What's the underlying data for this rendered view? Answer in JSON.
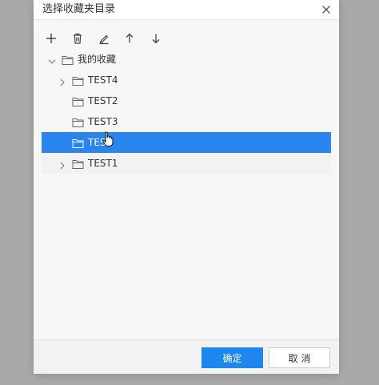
{
  "dialog": {
    "title": "选择收藏夹目录",
    "close_icon": "close-icon"
  },
  "toolbar": {
    "items": [
      {
        "name": "add-button",
        "icon": "plus-icon"
      },
      {
        "name": "delete-button",
        "icon": "trash-icon"
      },
      {
        "name": "rename-button",
        "icon": "pencil-icon"
      },
      {
        "name": "move-up-button",
        "icon": "arrow-up-icon"
      },
      {
        "name": "move-down-button",
        "icon": "arrow-down-icon"
      }
    ]
  },
  "tree": {
    "root": {
      "label": "我的收藏",
      "expanded": true
    },
    "items": [
      {
        "label": "TEST4",
        "has_children": true,
        "selected": false
      },
      {
        "label": "TEST2",
        "has_children": false,
        "selected": false
      },
      {
        "label": "TEST3",
        "has_children": false,
        "selected": false
      },
      {
        "label": "TEST",
        "has_children": false,
        "selected": true
      },
      {
        "label": "TEST1",
        "has_children": true,
        "selected": false
      }
    ]
  },
  "footer": {
    "ok_label": "确定",
    "cancel_label": "取消"
  },
  "colors": {
    "accent": "#2a86ee",
    "button_primary": "#1e86ef",
    "backdrop": "#a9a9a9"
  }
}
